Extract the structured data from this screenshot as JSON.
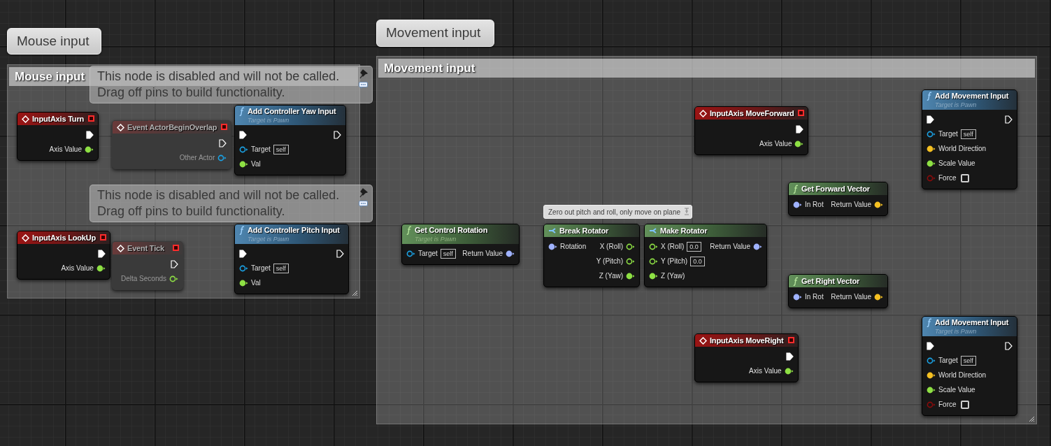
{
  "comments": [
    {
      "bubble": "Mouse input",
      "title": "Mouse input"
    },
    {
      "bubble": "Movement input",
      "title": "Movement input"
    }
  ],
  "disabled_notes": [
    {
      "text": "This node is disabled and will not be called.\nDrag off pins to build functionality."
    },
    {
      "text": "This node is disabled and will not be called.\nDrag off pins to build functionality."
    }
  ],
  "nodes": [
    {
      "kind": "event",
      "title": "InputAxis Turn",
      "disabled": false,
      "outputs": [
        {
          "kind": "exec",
          "connected": true
        },
        {
          "kind": "float",
          "label": "Axis Value",
          "connected": true
        }
      ]
    },
    {
      "kind": "event",
      "title": "Event ActorBeginOverlap",
      "disabled": true,
      "outputs": [
        {
          "kind": "exec",
          "connected": false
        },
        {
          "kind": "object",
          "label": "Other Actor",
          "connected": false
        }
      ]
    },
    {
      "kind": "function",
      "title": "Add Controller Yaw Input",
      "subtitle": "Target is Pawn",
      "disabled": false,
      "inputs": [
        {
          "kind": "exec",
          "connected": true
        },
        {
          "kind": "object",
          "label": "Target",
          "default": "self",
          "connected": false
        },
        {
          "kind": "float",
          "label": "Val",
          "connected": true
        }
      ],
      "outputs": [
        {
          "kind": "exec",
          "connected": false
        }
      ]
    },
    {
      "kind": "event",
      "title": "InputAxis LookUp",
      "disabled": false,
      "outputs": [
        {
          "kind": "exec",
          "connected": true
        },
        {
          "kind": "float",
          "label": "Axis Value",
          "connected": true
        }
      ]
    },
    {
      "kind": "event",
      "title": "Event Tick",
      "disabled": true,
      "outputs": [
        {
          "kind": "exec",
          "connected": false
        },
        {
          "kind": "float",
          "label": "Delta Seconds",
          "connected": false
        }
      ]
    },
    {
      "kind": "function",
      "title": "Add Controller Pitch Input",
      "subtitle": "Target is Pawn",
      "disabled": false,
      "inputs": [
        {
          "kind": "exec",
          "connected": true
        },
        {
          "kind": "object",
          "label": "Target",
          "default": "self",
          "connected": false
        },
        {
          "kind": "float",
          "label": "Val",
          "connected": true
        }
      ],
      "outputs": [
        {
          "kind": "exec",
          "connected": false
        }
      ]
    },
    {
      "kind": "pure",
      "title": "Get Control Rotation",
      "subtitle": "Target is Pawn",
      "disabled": false,
      "inputs": [
        {
          "kind": "object",
          "label": "Target",
          "default": "self",
          "connected": false
        }
      ],
      "outputs": [
        {
          "kind": "rotator",
          "label": "Return Value",
          "connected": true
        }
      ]
    },
    {
      "kind": "struct",
      "title": "Break Rotator",
      "comment": "Zero out pitch and roll, only move on plane",
      "disabled": false,
      "inputs": [
        {
          "kind": "rotator",
          "label": "Rotation",
          "connected": true
        }
      ],
      "outputs": [
        {
          "kind": "float",
          "label": "X (Roll)",
          "connected": false
        },
        {
          "kind": "float",
          "label": "Y (Pitch)",
          "connected": false
        },
        {
          "kind": "float",
          "label": "Z (Yaw)",
          "connected": true
        }
      ]
    },
    {
      "kind": "struct",
      "title": "Make Rotator",
      "disabled": false,
      "inputs": [
        {
          "kind": "float",
          "label": "X (Roll)",
          "default": "0.0",
          "connected": false
        },
        {
          "kind": "float",
          "label": "Y (Pitch)",
          "default": "0.0",
          "connected": false
        },
        {
          "kind": "float",
          "label": "Z (Yaw)",
          "connected": true
        }
      ],
      "outputs": [
        {
          "kind": "rotator",
          "label": "Return Value",
          "connected": true
        }
      ]
    },
    {
      "kind": "event",
      "title": "InputAxis MoveForward",
      "disabled": false,
      "outputs": [
        {
          "kind": "exec",
          "connected": true
        },
        {
          "kind": "float",
          "label": "Axis Value",
          "connected": true
        }
      ]
    },
    {
      "kind": "pure",
      "title": "Get Forward Vector",
      "disabled": false,
      "inputs": [
        {
          "kind": "rotator",
          "label": "In Rot",
          "connected": true
        }
      ],
      "outputs": [
        {
          "kind": "vector",
          "label": "Return Value",
          "connected": true
        }
      ]
    },
    {
      "kind": "pure",
      "title": "Get Right Vector",
      "disabled": false,
      "inputs": [
        {
          "kind": "rotator",
          "label": "In Rot",
          "connected": true
        }
      ],
      "outputs": [
        {
          "kind": "vector",
          "label": "Return Value",
          "connected": true
        }
      ]
    },
    {
      "kind": "function",
      "title": "Add Movement Input",
      "subtitle": "Target is Pawn",
      "disabled": false,
      "inputs": [
        {
          "kind": "exec",
          "connected": true
        },
        {
          "kind": "object",
          "label": "Target",
          "default": "self",
          "connected": false
        },
        {
          "kind": "vector",
          "label": "World Direction",
          "connected": true
        },
        {
          "kind": "float",
          "label": "Scale Value",
          "connected": true
        },
        {
          "kind": "bool",
          "label": "Force",
          "checked": false,
          "connected": false
        }
      ],
      "outputs": [
        {
          "kind": "exec",
          "connected": false
        }
      ]
    },
    {
      "kind": "event",
      "title": "InputAxis MoveRight",
      "disabled": false,
      "outputs": [
        {
          "kind": "exec",
          "connected": true
        },
        {
          "kind": "float",
          "label": "Axis Value",
          "connected": true
        }
      ]
    },
    {
      "kind": "function",
      "title": "Add Movement Input",
      "subtitle": "Target is Pawn",
      "disabled": false,
      "inputs": [
        {
          "kind": "exec",
          "connected": true
        },
        {
          "kind": "object",
          "label": "Target",
          "default": "self",
          "connected": false
        },
        {
          "kind": "vector",
          "label": "World Direction",
          "connected": true
        },
        {
          "kind": "float",
          "label": "Scale Value",
          "connected": true
        },
        {
          "kind": "bool",
          "label": "Force",
          "checked": false,
          "connected": false
        }
      ],
      "outputs": [
        {
          "kind": "exec",
          "connected": false
        }
      ]
    }
  ]
}
